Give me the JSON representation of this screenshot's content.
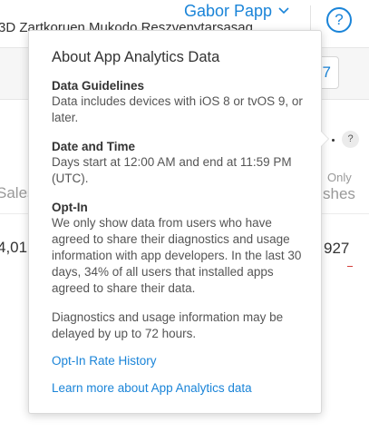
{
  "header": {
    "org_name": "3D Zartkoruen Mukodo Reszvenytarsasag",
    "user_name": "Gabor Papp",
    "help_label": "?"
  },
  "toolbar": {
    "date_button_label": "7"
  },
  "table": {
    "info_label": "?",
    "col_left_label": "Sales",
    "col_right_top_label": "Only",
    "col_right_label": "shes",
    "row_left_value": "4,01",
    "row_right_value": "927"
  },
  "popover": {
    "title": "About App Analytics Data",
    "sections": [
      {
        "heading": "Data Guidelines",
        "body": "Data includes devices with iOS 8 or tvOS 9, or later."
      },
      {
        "heading": "Date and Time",
        "body": "Days start at 12:00 AM and end at 11:59 PM (UTC)."
      },
      {
        "heading": "Opt-In",
        "body": "We only show data from users who have agreed to share their diagnostics and usage information with app developers. In the last 30 days, 34% of all users that installed apps agreed to share their data."
      }
    ],
    "note": "Diagnostics and usage information may be delayed by up to 72 hours.",
    "links": {
      "opt_in_history": "Opt-In Rate History",
      "learn_more": "Learn more about App Analytics data"
    }
  },
  "colors": {
    "accent": "#1a84d8",
    "text": "#555555",
    "heading": "#333333",
    "negative": "#d4403c"
  }
}
